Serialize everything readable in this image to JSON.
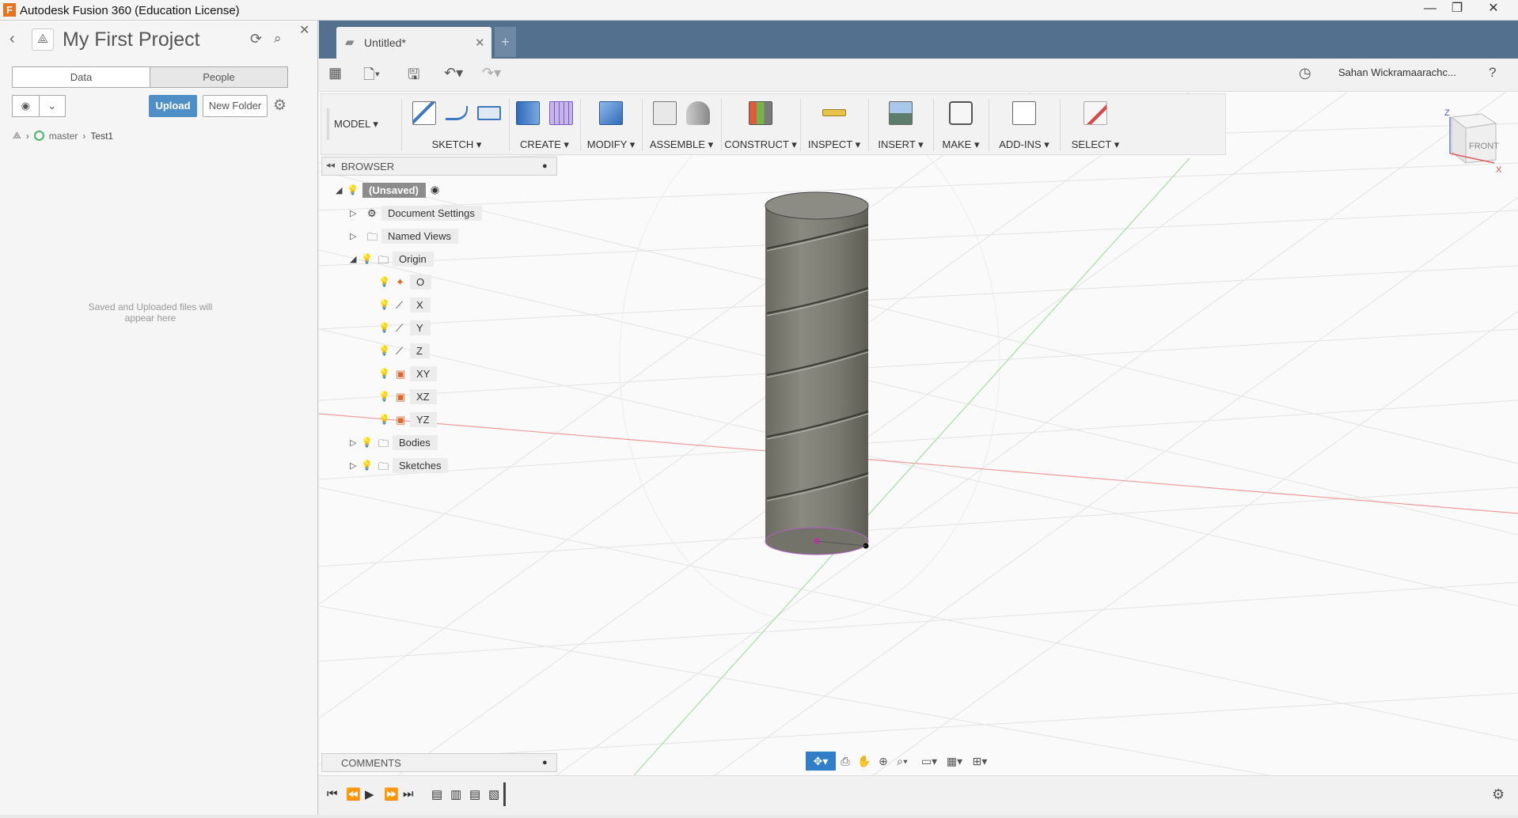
{
  "window": {
    "title": "Autodesk Fusion 360 (Education License)",
    "app_icon": "F",
    "minimize": "—",
    "restore": "❐",
    "close": "✕"
  },
  "data_panel": {
    "project_title": "My First Project",
    "tabs": [
      "Data",
      "People"
    ],
    "upload_label": "Upload",
    "new_folder_label": "New Folder",
    "breadcrumb": {
      "branch": "master",
      "folder": "Test1"
    },
    "empty_message": "Saved and Uploaded files will appear here"
  },
  "document": {
    "tab_label": "Untitled*",
    "new_tab": "+"
  },
  "quick_access": {
    "user_name": "Sahan Wickramaarachc...",
    "help": "?"
  },
  "ribbon": {
    "workspace": "MODEL ▾",
    "groups": [
      {
        "label": "SKETCH ▾"
      },
      {
        "label": "CREATE ▾"
      },
      {
        "label": "MODIFY ▾"
      },
      {
        "label": "ASSEMBLE ▾"
      },
      {
        "label": "CONSTRUCT ▾"
      },
      {
        "label": "INSPECT ▾"
      },
      {
        "label": "INSERT ▾"
      },
      {
        "label": "MAKE ▾"
      },
      {
        "label": "ADD-INS ▾"
      },
      {
        "label": "SELECT ▾"
      }
    ]
  },
  "browser": {
    "title": "BROWSER",
    "root": "(Unsaved)",
    "items": [
      {
        "label": "Document Settings"
      },
      {
        "label": "Named Views"
      },
      {
        "label": "Origin"
      },
      {
        "label": "O"
      },
      {
        "label": "X"
      },
      {
        "label": "Y"
      },
      {
        "label": "Z"
      },
      {
        "label": "XY"
      },
      {
        "label": "XZ"
      },
      {
        "label": "YZ"
      },
      {
        "label": "Bodies"
      },
      {
        "label": "Sketches"
      }
    ]
  },
  "comments": {
    "title": "COMMENTS"
  },
  "viewcube": {
    "face": "FRONT",
    "axis_z": "Z",
    "axis_x": "X"
  },
  "colors": {
    "header_blue": "#53708e",
    "accent_blue": "#2f7ec7",
    "upload_blue": "#4f8fc8",
    "x_axis": "#e48b8b",
    "y_axis": "#8fd48f",
    "body_gray": "#7a7a70"
  }
}
